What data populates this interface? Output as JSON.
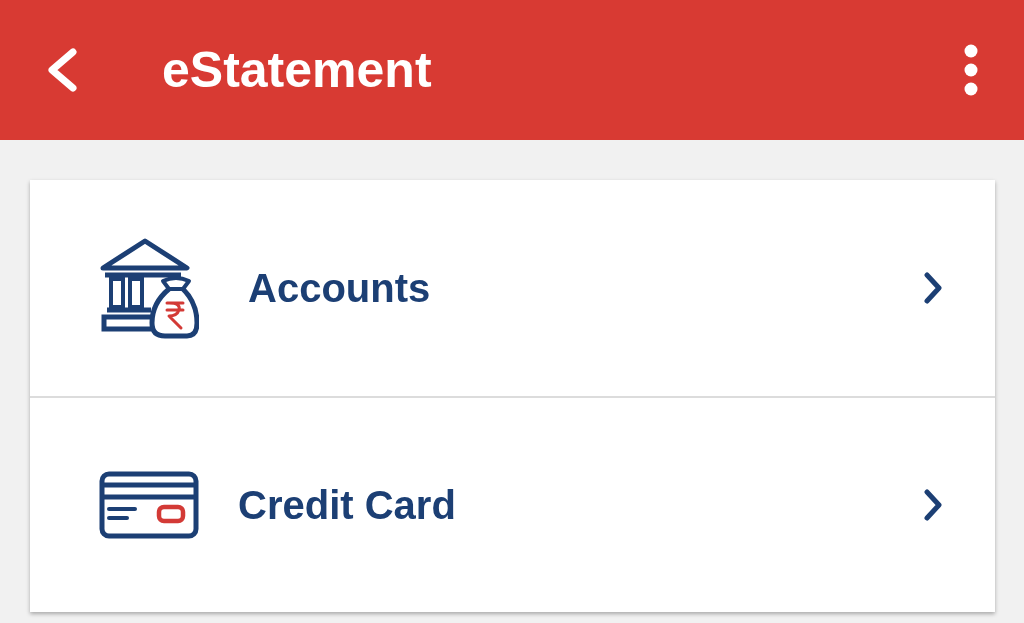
{
  "app_bar": {
    "title": "eStatement"
  },
  "menu_items": [
    {
      "kind": "accounts",
      "label": "Accounts"
    },
    {
      "kind": "credit_card",
      "label": "Credit Card"
    }
  ]
}
